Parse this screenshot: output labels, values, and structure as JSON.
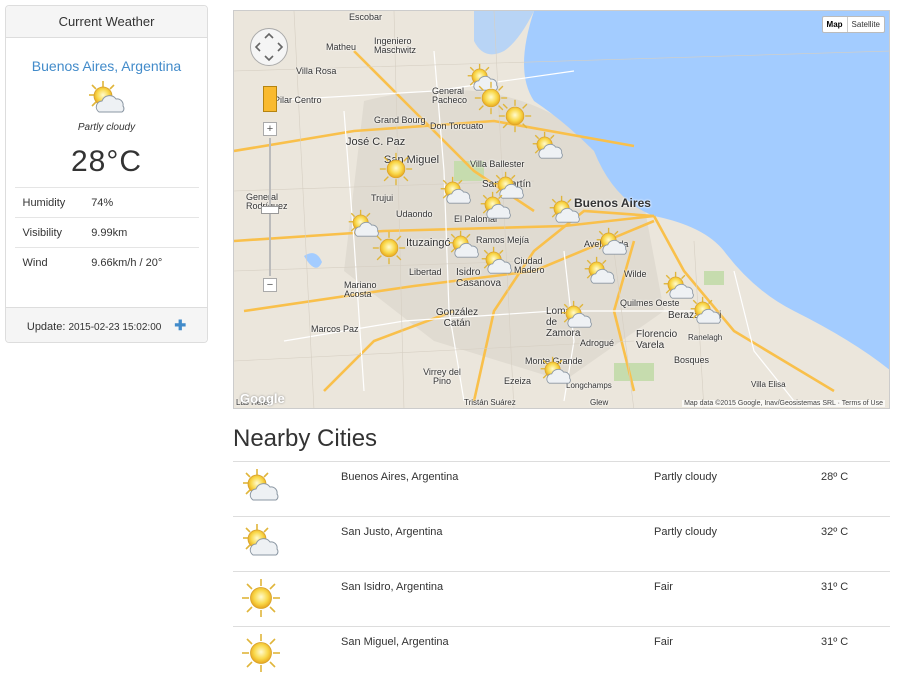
{
  "weather_panel": {
    "heading": "Current Weather",
    "city": "Buenos Aires, Argentina",
    "condition": "Partly cloudy",
    "icon": "partly-cloudy-icon",
    "temperature": "28°C",
    "stats": [
      {
        "label": "Humidity",
        "value": "74%"
      },
      {
        "label": "Visibility",
        "value": "9.99km"
      },
      {
        "label": "Wind",
        "value": "9.66km/h / 20°"
      }
    ],
    "update_label": "Update:",
    "update_time": "2015-02-23 15:02:00",
    "add_icon": "plus-icon"
  },
  "map": {
    "type_buttons": [
      "Map",
      "Satellite"
    ],
    "zoom_in": "+",
    "zoom_out": "−",
    "attribution": "Map data ©2015 Google, Inav/Geosistemas SRL · Terms of Use",
    "logo": "Google",
    "labels": [
      "Escobar",
      "Matheu",
      "Ingeniero Maschwitz",
      "Villa Rosa",
      "Pilar Centro",
      "General Pacheco",
      "Grand Bourg",
      "Don Torcuato",
      "José C. Paz",
      "San Miguel",
      "Villa Ballester",
      "San Martín",
      "Buenos Aires",
      "Trujui",
      "Udaondo",
      "El Palomar",
      "General Rodríguez",
      "Ituzaingó",
      "Ramos Mejía",
      "Ciudad Madero",
      "Avellaneda",
      "Libertad",
      "Isidro Casanova",
      "Wilde",
      "Mariano Acosta",
      "Quilmes Oeste",
      "González Catán",
      "Lomas de Zamora",
      "Berazategui",
      "Marcos Paz",
      "Adrogué",
      "Florencio Varela",
      "Ranelagh",
      "Bosques",
      "Monte Grande",
      "Virrey del Pino",
      "Ezeiza",
      "Longchamps",
      "Villa Elisa",
      "Las Heras",
      "Tristán Suárez",
      "Glew"
    ],
    "marker_icons": [
      "partly-cloudy-icon",
      "sun-icon"
    ]
  },
  "nearby": {
    "title": "Nearby Cities",
    "rows": [
      {
        "icon": "partly-cloudy-icon",
        "city": "Buenos Aires, Argentina",
        "condition": "Partly cloudy",
        "temp": "28º C"
      },
      {
        "icon": "partly-cloudy-icon",
        "city": "San Justo, Argentina",
        "condition": "Partly cloudy",
        "temp": "32º C"
      },
      {
        "icon": "sun-icon",
        "city": "San Isidro, Argentina",
        "condition": "Fair",
        "temp": "31º C"
      },
      {
        "icon": "sun-icon",
        "city": "San Miguel, Argentina",
        "condition": "Fair",
        "temp": "31º C"
      }
    ]
  }
}
